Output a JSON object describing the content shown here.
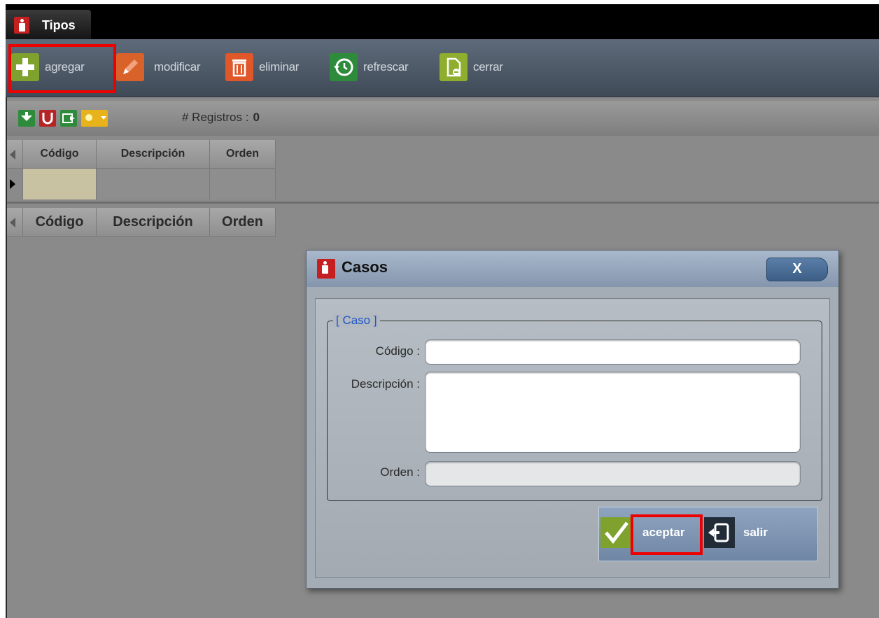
{
  "window": {
    "tab_title": "Tipos"
  },
  "toolbar": {
    "add_label": "agregar",
    "edit_label": "modificar",
    "delete_label": "eliminar",
    "refresh_label": "refrescar",
    "close_label": "cerrar"
  },
  "subbar": {
    "records_label": "# Registros :",
    "records_count": "0"
  },
  "grid_top": {
    "columns": [
      "Código",
      "Descripción",
      "Orden"
    ]
  },
  "grid_bottom": {
    "columns": [
      "Código",
      "Descripción",
      "Orden"
    ]
  },
  "dialog": {
    "title": "Casos",
    "close_label": "X",
    "group_label": "[ Caso ]",
    "code_label": "Código :",
    "code_value": "",
    "description_label": "Descripción :",
    "description_value": "",
    "order_label": "Orden :",
    "order_value": "",
    "accept_label": "aceptar",
    "exit_label": "salir"
  },
  "colors": {
    "highlight": "#ee0000",
    "add_icon": "#7fa12e",
    "edit_icon": "#d9622b",
    "delete_icon": "#e0572a",
    "refresh_icon": "#2e8b3c",
    "close_icon": "#8fae2e",
    "legend": "#1f55c9"
  },
  "icons": {
    "tab": "app-person-icon",
    "add": "plus-icon",
    "edit": "pencil-icon",
    "delete": "trash-icon",
    "refresh": "refresh-clock-icon",
    "close": "document-close-icon",
    "accept": "checkmark-icon",
    "exit": "exit-door-icon"
  }
}
